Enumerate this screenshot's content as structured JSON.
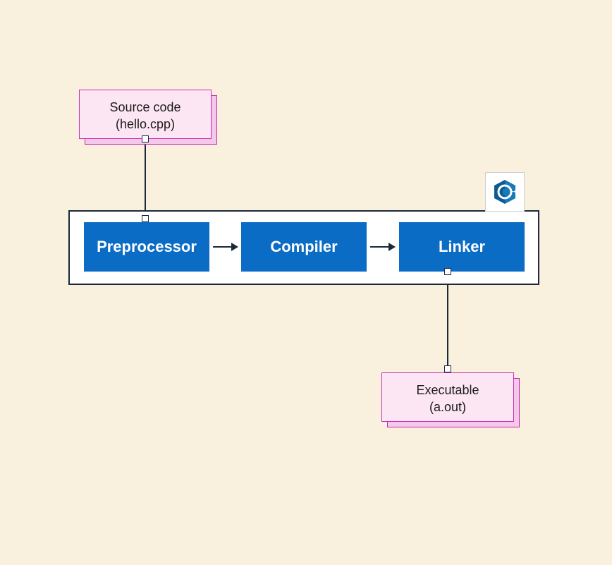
{
  "source_box": {
    "line1": "Source code",
    "line2": "(hello.cpp)"
  },
  "stages": {
    "preprocessor": "Preprocessor",
    "compiler": "Compiler",
    "linker": "Linker"
  },
  "output_box": {
    "line1": "Executable",
    "line2": "(a.out)"
  },
  "logo_name": "cpp-logo"
}
